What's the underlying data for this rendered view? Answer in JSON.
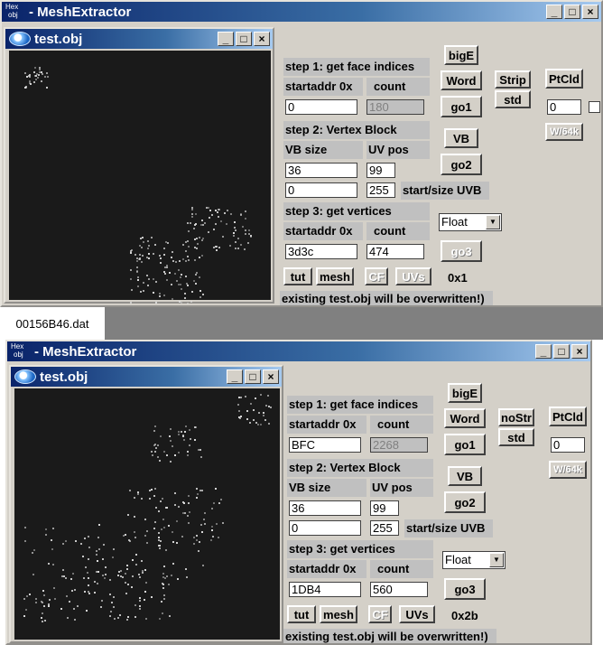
{
  "top": {
    "app_title": "MeshExtractor",
    "icon_text_1": "Hex",
    "icon_text_2": "obj",
    "child_title": "test.obj",
    "step1_label": "step 1: get face indices",
    "startaddr_label": "startaddr 0x",
    "count_label": "count",
    "startaddr_value": "0",
    "count_value": "180",
    "step2_label": "step 2: Vertex Block",
    "vbsize_label": "VB size",
    "uvpos_label": "UV pos",
    "vbsize_value": "36",
    "uvpos_value": "99",
    "uvb_start_value": "0",
    "uvb_size_value": "255",
    "uvb_label": "start/size UVB",
    "step3_label": "step 3: get vertices",
    "startaddr3_label": "startaddr 0x",
    "count3_label": "count",
    "startaddr3_value": "3d3c",
    "count3_value": "474",
    "bigE_label": "bigE",
    "word_label": "Word",
    "strip_label": "Strip",
    "ptcld_label": "PtCld",
    "std_label": "std",
    "go1_label": "go1",
    "ptcld_value": "0",
    "w64_label": "W/64k",
    "vb_label": "VB",
    "go2_label": "go2",
    "float_value": "Float",
    "go3_label": "go3",
    "hex_readout": "0x1",
    "tut_label": "tut",
    "mesh_label": "mesh",
    "cf_label": "CF",
    "uvs_label": "UVs",
    "warning": "existing test.obj will be overwritten!)"
  },
  "dat_tab": "00156B46.dat",
  "bottom": {
    "app_title": "MeshExtractor",
    "icon_text_1": "Hex",
    "icon_text_2": "obj",
    "child_title": "test.obj",
    "step1_label": "step 1: get face indices",
    "startaddr_label": "startaddr 0x",
    "count_label": "count",
    "startaddr_value": "BFC",
    "count_value": "2268",
    "step2_label": "step 2: Vertex Block",
    "vbsize_label": "VB size",
    "uvpos_label": "UV pos",
    "vbsize_value": "36",
    "uvpos_value": "99",
    "uvb_start_value": "0",
    "uvb_size_value": "255",
    "uvb_label": "start/size UVB",
    "step3_label": "step 3: get vertices",
    "startaddr3_label": "startaddr 0x",
    "count3_label": "count",
    "startaddr3_value": "1DB4",
    "count3_value": "560",
    "bigE_label": "bigE",
    "word_label": "Word",
    "strip_label": "noStr",
    "ptcld_label": "PtCld",
    "std_label": "std",
    "go1_label": "go1",
    "ptcld_value": "0",
    "w64_label": "W/64k",
    "vb_label": "VB",
    "go2_label": "go2",
    "float_value": "Float",
    "go3_label": "go3",
    "hex_readout": "0x2b",
    "tut_label": "tut",
    "mesh_label": "mesh",
    "cf_label": "CF",
    "uvs_label": "UVs",
    "warning": "existing test.obj will be overwritten!)"
  },
  "icons": [
    "minimize-icon",
    "maximize-icon",
    "close-icon",
    "app-icon",
    "obj-file-icon",
    "dropdown-arrow-icon"
  ],
  "colors": {
    "titlebar_start": "#0a246a",
    "titlebar_end": "#a6caf0",
    "panel": "#d4d0c8",
    "canvas": "#1a1a1a"
  }
}
